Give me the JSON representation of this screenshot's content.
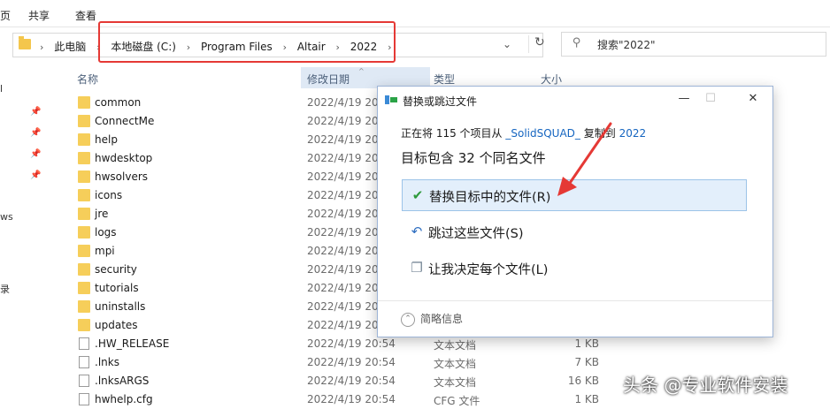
{
  "ribbon": {
    "tab_file": "页",
    "tab_share": "共享",
    "tab_view": "查看"
  },
  "address": {
    "crumbs": [
      "此电脑",
      "本地磁盘 (C:)",
      "Program Files",
      "Altair",
      "2022"
    ],
    "separator": "›",
    "dropdown_glyph": "⌄",
    "refresh_glyph": "↻"
  },
  "search": {
    "placeholder": "搜索\"2022\""
  },
  "navpane": {
    "frag1": "l",
    "frag2": "ws",
    "frag3": "录"
  },
  "columns": {
    "name": "名称",
    "date": "修改日期",
    "type": "类型",
    "size": "大小"
  },
  "files": [
    {
      "name": "common",
      "date": "2022/4/19 20:54",
      "type": "",
      "size": "",
      "kind": "folder"
    },
    {
      "name": "ConnectMe",
      "date": "2022/4/19 20:54",
      "type": "",
      "size": "",
      "kind": "folder"
    },
    {
      "name": "help",
      "date": "2022/4/19 20:54",
      "type": "",
      "size": "",
      "kind": "folder"
    },
    {
      "name": "hwdesktop",
      "date": "2022/4/19 20:54",
      "type": "",
      "size": "",
      "kind": "folder"
    },
    {
      "name": "hwsolvers",
      "date": "2022/4/19 20:54",
      "type": "",
      "size": "",
      "kind": "folder"
    },
    {
      "name": "icons",
      "date": "2022/4/19 20:54",
      "type": "",
      "size": "",
      "kind": "folder"
    },
    {
      "name": "jre",
      "date": "2022/4/19 20:54",
      "type": "",
      "size": "",
      "kind": "folder"
    },
    {
      "name": "logs",
      "date": "2022/4/19 20:54",
      "type": "",
      "size": "",
      "kind": "folder"
    },
    {
      "name": "mpi",
      "date": "2022/4/19 20:54",
      "type": "",
      "size": "",
      "kind": "folder"
    },
    {
      "name": "security",
      "date": "2022/4/19 20:54",
      "type": "",
      "size": "",
      "kind": "folder"
    },
    {
      "name": "tutorials",
      "date": "2022/4/19 20:54",
      "type": "",
      "size": "",
      "kind": "folder"
    },
    {
      "name": "uninstalls",
      "date": "2022/4/19 20:54",
      "type": "",
      "size": "",
      "kind": "folder"
    },
    {
      "name": "updates",
      "date": "2022/4/19 20:54",
      "type": "",
      "size": "",
      "kind": "folder"
    },
    {
      "name": ".HW_RELEASE",
      "date": "2022/4/19 20:54",
      "type": "文本文档",
      "size": "1 KB",
      "kind": "file"
    },
    {
      "name": ".lnks",
      "date": "2022/4/19 20:54",
      "type": "文本文档",
      "size": "7 KB",
      "kind": "file"
    },
    {
      "name": ".lnksARGS",
      "date": "2022/4/19 20:54",
      "type": "文本文档",
      "size": "16 KB",
      "kind": "file"
    },
    {
      "name": "hwhelp.cfg",
      "date": "2022/4/19 20:54",
      "type": "CFG 文件",
      "size": "1 KB",
      "kind": "file"
    }
  ],
  "dialog": {
    "title": "替换或跳过文件",
    "minimize": "—",
    "maximize": "☐",
    "close": "✕",
    "sub_prefix": "正在将 115 个项目从",
    "sub_source": "_SolidSQUAD_",
    "sub_middle": "复制到",
    "sub_dest": "2022",
    "heading": "目标包含 32 个同名文件",
    "options": [
      {
        "icon": "✔",
        "label": "替换目标中的文件(R)",
        "selected": true,
        "icon_color": "#2e9a3c"
      },
      {
        "icon": "↶",
        "label": "跳过这些文件(S)",
        "selected": false,
        "icon_color": "#2f6fc0"
      },
      {
        "icon": "❐",
        "label": "让我决定每个文件(L)",
        "selected": false,
        "icon_color": "#7a8a99"
      }
    ],
    "details_glyph": "⌃",
    "details": "简略信息"
  },
  "watermark": "头条 @专业软件安装",
  "colors": {
    "highlight": "#e53935",
    "link": "#1565c0",
    "selection": "#e3effb"
  }
}
